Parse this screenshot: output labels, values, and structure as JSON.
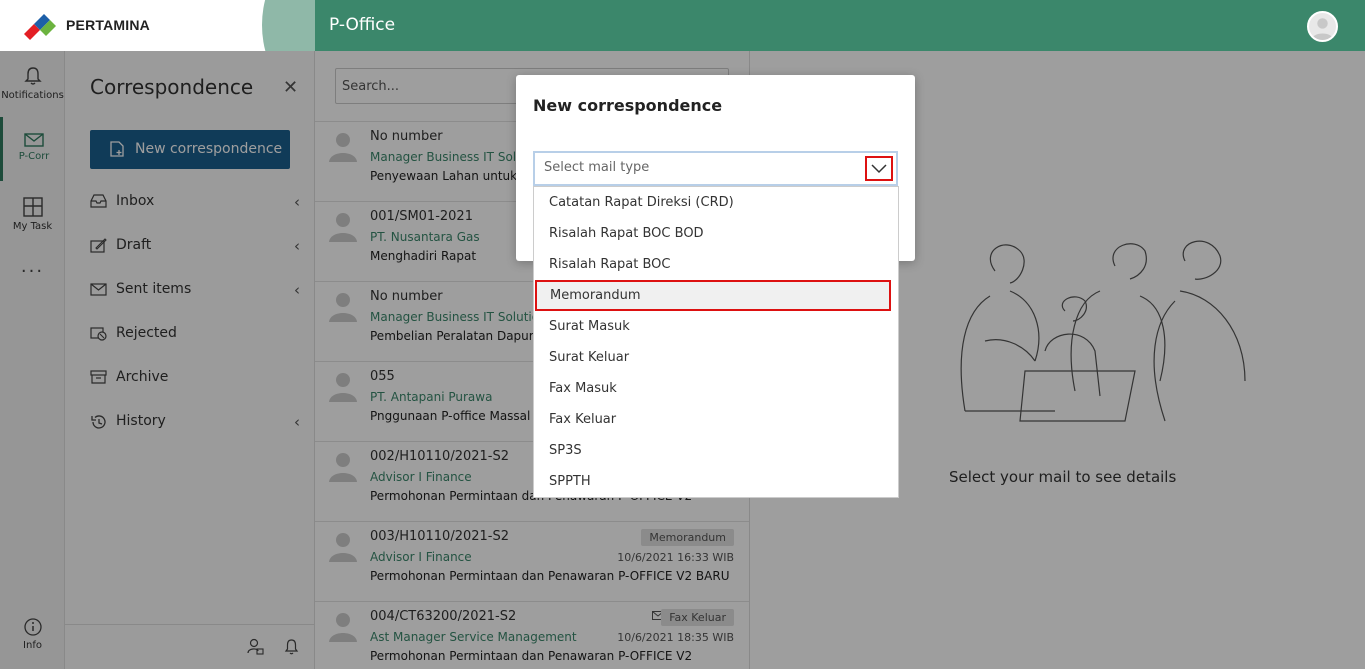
{
  "header": {
    "brand": "PERTAMINA",
    "app_title": "P-Office"
  },
  "rail": {
    "notifications": "Notifications",
    "pcorr": "P-Corr",
    "mytask": "My Task",
    "more": "...",
    "info": "Info"
  },
  "folders": {
    "title": "Correspondence",
    "new_button": "New correspondence",
    "items": [
      {
        "label": "Inbox"
      },
      {
        "label": "Draft"
      },
      {
        "label": "Sent items"
      },
      {
        "label": "Rejected"
      },
      {
        "label": "Archive"
      },
      {
        "label": "History"
      }
    ]
  },
  "list": {
    "search_placeholder": "Search...",
    "mails": [
      {
        "number": "No number",
        "from": "Manager Business IT Solution",
        "subject": "Penyewaan Lahan untuk U"
      },
      {
        "number": "001/SM01-2021",
        "from": "PT. Nusantara Gas",
        "subject": "Menghadiri Rapat"
      },
      {
        "number": "No number",
        "from": "Manager Business IT Solution",
        "subject": "Pembelian Peralatan Dapur d"
      },
      {
        "number": "055",
        "from": "PT. Antapani Purawa",
        "subject": "Pnggunaan P-office Massal"
      },
      {
        "number": "002/H10110/2021-S2",
        "from": "Advisor I Finance",
        "subject": "Permohonan Permintaan dan Penawaran P-OFFICE V2"
      },
      {
        "number": "003/H10110/2021-S2",
        "from": "Advisor I Finance",
        "subject": "Permohonan Permintaan dan Penawaran P-OFFICE V2 BARU",
        "badge": "Memorandum",
        "date": "10/6/2021 16:33 WIB"
      },
      {
        "number": "004/CT63200/2021-S2",
        "from": "Ast Manager Service Management",
        "subject": "Permohonan Permintaan dan Penawaran P-OFFICE V2",
        "badge": "Fax Keluar",
        "date": "10/6/2021 18:35 WIB"
      }
    ]
  },
  "detail": {
    "empty_text": "Select your mail to see details"
  },
  "modal": {
    "title": "New correspondence",
    "select_placeholder": "Select mail type",
    "options": [
      "Catatan Rapat Direksi (CRD)",
      "Risalah Rapat BOC BOD",
      "Risalah Rapat BOC",
      "Memorandum",
      "Surat Masuk",
      "Surat Keluar",
      "Fax Masuk",
      "Fax Keluar",
      "SP3S",
      "SPPTH"
    ],
    "highlighted_option": "Memorandum"
  },
  "colors": {
    "brand_green": "#3b876b",
    "button_blue": "#1a5f8f",
    "highlight_red": "#dd1111"
  }
}
